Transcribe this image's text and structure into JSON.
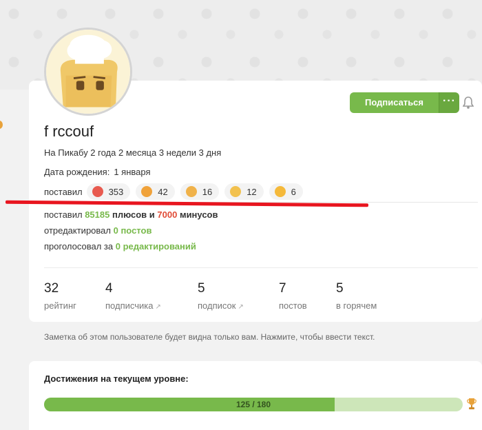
{
  "profile": {
    "username": "f rccouf",
    "age_text": "На Пикабу 2 года 2 месяца 3 недели 3 дня",
    "birthday_label": "Дата рождения:",
    "birthday_value": "1 января",
    "subscribe_label": "Подписаться",
    "more_label": "···"
  },
  "reactions": {
    "label": "поставил",
    "items": [
      {
        "icon": "clown-emoji-icon",
        "count": "353",
        "color": "#e85a4f"
      },
      {
        "icon": "shocked-emoji-icon",
        "count": "42",
        "color": "#f0a23a"
      },
      {
        "icon": "clap-emoji-icon",
        "count": "16",
        "color": "#f0b24a"
      },
      {
        "icon": "hot-emoji-icon",
        "count": "12",
        "color": "#f2c14e"
      },
      {
        "icon": "laugh-emoji-icon",
        "count": "6",
        "color": "#f5b93a"
      }
    ]
  },
  "votes": {
    "prefix": "поставил",
    "plus": "85185",
    "mid": "плюсов и",
    "minus": "7000",
    "suffix": "минусов"
  },
  "edits": {
    "prefix": "отредактировал",
    "value": "0 постов"
  },
  "voted": {
    "prefix": "проголосовал за",
    "value": "0 редактирований"
  },
  "stats": [
    {
      "num": "32",
      "label": "рейтинг"
    },
    {
      "num": "4",
      "label": "подписчика"
    },
    {
      "num": "5",
      "label": "подписок"
    },
    {
      "num": "7",
      "label": "постов"
    },
    {
      "num": "5",
      "label": "в горячем"
    }
  ],
  "note": "Заметка об этом пользователе будет видна только вам. Нажмите, чтобы ввести текст.",
  "achievements": {
    "title": "Достижения на текущем уровне:",
    "progress_text": "125 / 180",
    "progress_fraction": 0.694
  },
  "colors": {
    "accent": "#78b94b",
    "minus": "#e14b36",
    "annotation": "#e8151f"
  }
}
